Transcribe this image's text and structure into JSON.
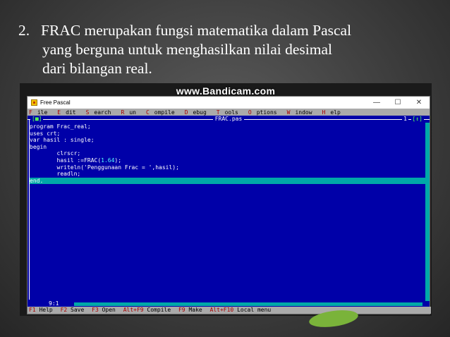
{
  "slide": {
    "number": "2.",
    "line1": "FRAC merupakan fungsi matematika dalam Pascal",
    "line2": "yang berguna untuk menghasilkan nilai desimal",
    "line3": "dari bilangan real."
  },
  "watermark": "www.Bandicam.com",
  "window": {
    "title": "Free Pascal",
    "minimize": "—",
    "maximize": "☐",
    "close": "✕"
  },
  "menu": [
    {
      "hot": "F",
      "rest": "ile"
    },
    {
      "hot": "E",
      "rest": "dit"
    },
    {
      "hot": "S",
      "rest": "earch"
    },
    {
      "hot": "R",
      "rest": "un"
    },
    {
      "hot": "C",
      "rest": "ompile"
    },
    {
      "hot": "D",
      "rest": "ebug"
    },
    {
      "hot": "T",
      "rest": "ools"
    },
    {
      "hot": "O",
      "rest": "ptions"
    },
    {
      "hot": "W",
      "rest": "indow"
    },
    {
      "hot": "H",
      "rest": "elp"
    }
  ],
  "editor": {
    "close_marker": "[■]",
    "file_name": "FRAC.pas",
    "window_number": "1",
    "zoom_marker": "[↕]",
    "cursor_position": "9:1",
    "code": {
      "l1": "program Frac_real;",
      "l2": "uses crt;",
      "l3": "var hasil : single;",
      "l4": "begin",
      "l5": "        clrscr;",
      "l6_pre": "        hasil :=FRAC(",
      "l6_lit": "1.64",
      "l6_post": ");",
      "l7": "        writeln('Penggunaan Frac = ',hasil);",
      "l8": "        readln;",
      "l9": "end."
    }
  },
  "status": [
    {
      "key": "F1",
      "label": "Help"
    },
    {
      "key": "F2",
      "label": "Save"
    },
    {
      "key": "F3",
      "label": "Open"
    },
    {
      "key": "Alt+F9",
      "label": "Compile"
    },
    {
      "key": "F9",
      "label": "Make"
    },
    {
      "key": "Alt+F10",
      "label": "Local menu"
    }
  ]
}
